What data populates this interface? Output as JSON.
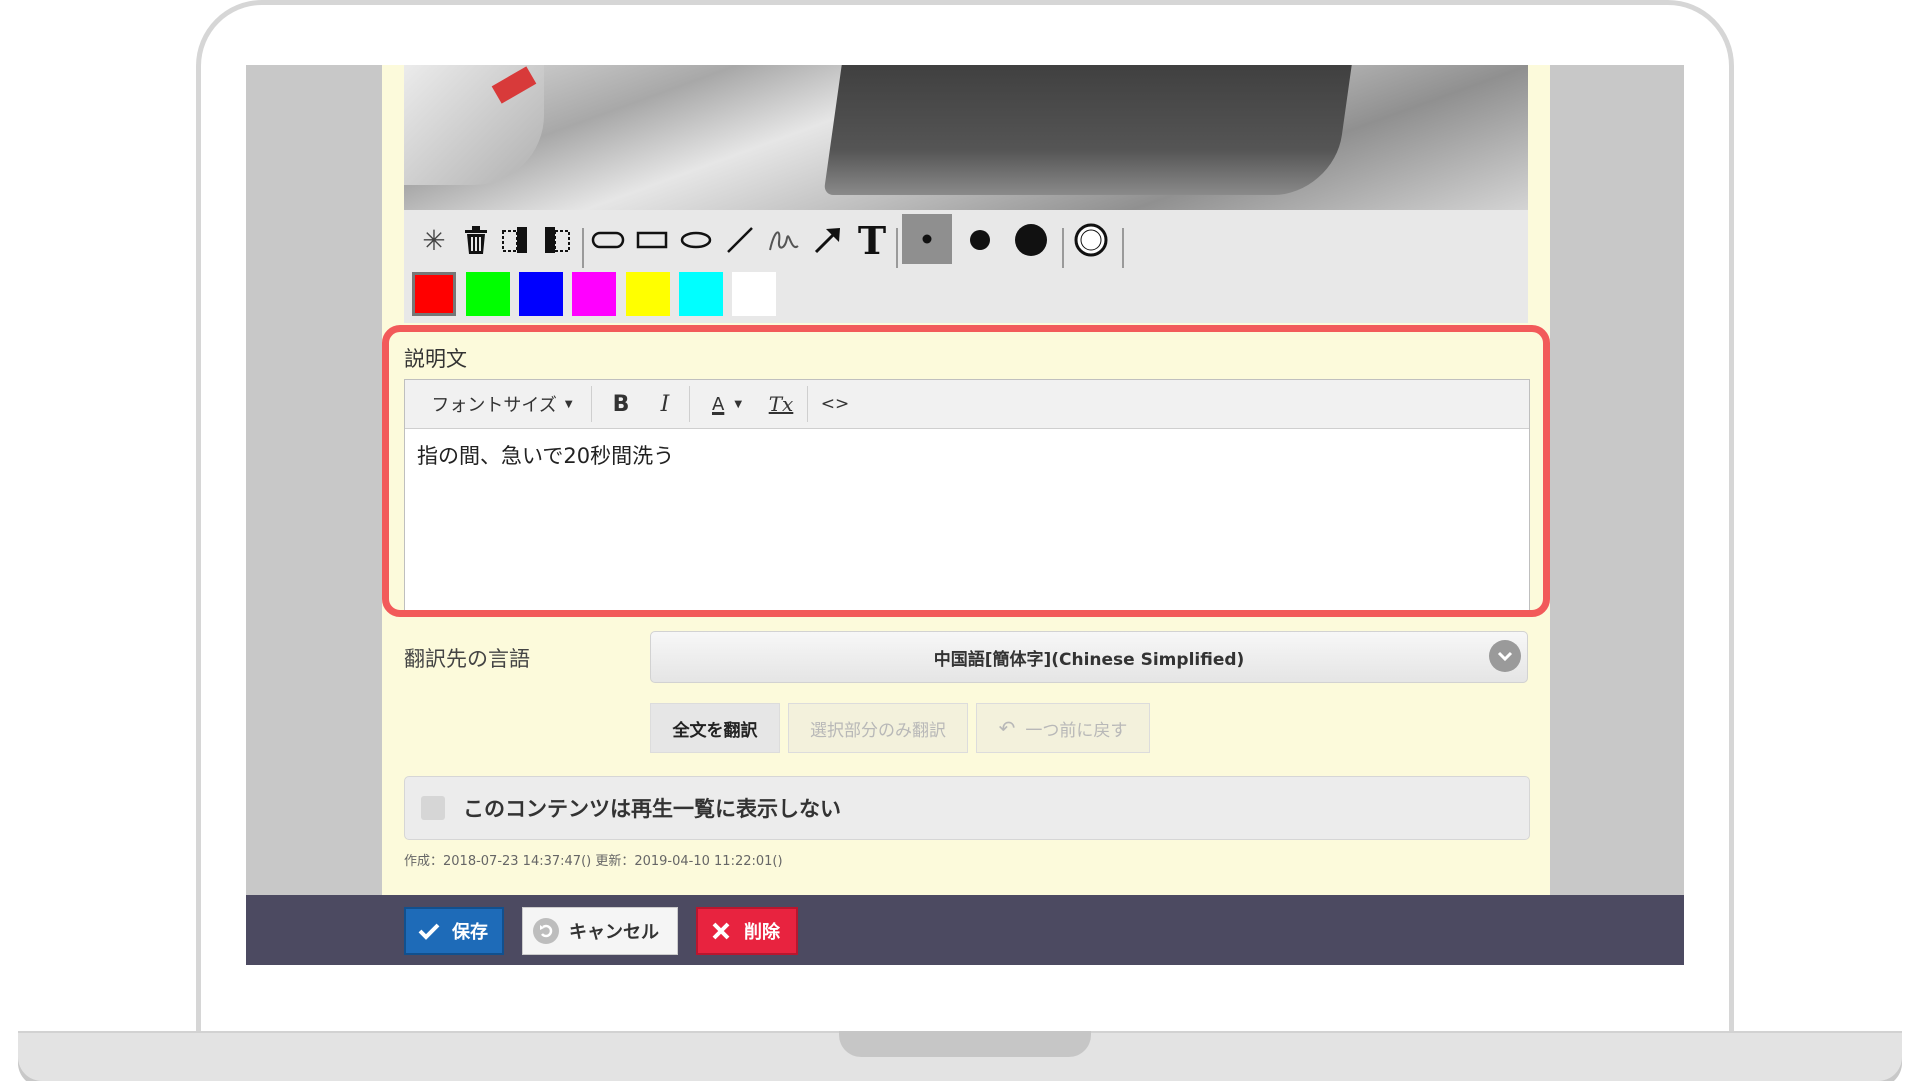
{
  "toolbar": {
    "tools": [
      {
        "name": "select-icon",
        "glyph": "✳"
      },
      {
        "name": "trash-icon",
        "glyph": "🗑"
      },
      {
        "name": "bring-back-icon",
        "glyph": "◧"
      },
      {
        "name": "bring-front-icon",
        "glyph": "◨"
      },
      {
        "name": "rounded-rect-icon",
        "glyph": "▭"
      },
      {
        "name": "rect-icon",
        "glyph": "□"
      },
      {
        "name": "ellipse-icon",
        "glyph": "⬭"
      },
      {
        "name": "line-icon",
        "glyph": "╱"
      },
      {
        "name": "freehand-icon",
        "glyph": "∿"
      },
      {
        "name": "arrow-icon",
        "glyph": "➚"
      },
      {
        "name": "text-icon",
        "glyph": "T"
      },
      {
        "name": "stroke-small-icon",
        "glyph": "●"
      },
      {
        "name": "stroke-medium-icon",
        "glyph": "●"
      },
      {
        "name": "stroke-large-icon",
        "glyph": "●"
      },
      {
        "name": "outline-circle-icon",
        "glyph": "◎"
      }
    ],
    "colors": [
      "#ff0000",
      "#00ff00",
      "#0000ff",
      "#ff00ff",
      "#ffff00",
      "#00ffff",
      "#ffffff"
    ]
  },
  "description": {
    "label": "説明文",
    "font_size_label": "フォントサイズ",
    "bold_glyph": "B",
    "italic_glyph": "I",
    "color_glyph": "A",
    "clear_glyph": "Tx",
    "code_glyph": "<>",
    "text": "指の間、急いで20秒間洗う"
  },
  "translate": {
    "label": "翻訳先の言語",
    "selected_language": "中国語[簡体字](Chinese Simplified)",
    "translate_all": "全文を翻訳",
    "translate_selection": "選択部分のみ翻訳",
    "undo": "一つ前に戻す"
  },
  "hide_checkbox_label": "このコンテンツは再生一覧に表示しない",
  "meta": "作成：2018-07-23 14:37:47()  更新：2019-04-10 11:22:01()",
  "footer": {
    "save": "保存",
    "cancel": "キャンセル",
    "delete": "削除"
  },
  "colors": {
    "save_bg": "#1e6bb8",
    "delete_bg": "#e8233f",
    "footer_bg": "#4c4a61",
    "panel_bg": "#fcfadb",
    "highlight": "#f25a5a"
  }
}
